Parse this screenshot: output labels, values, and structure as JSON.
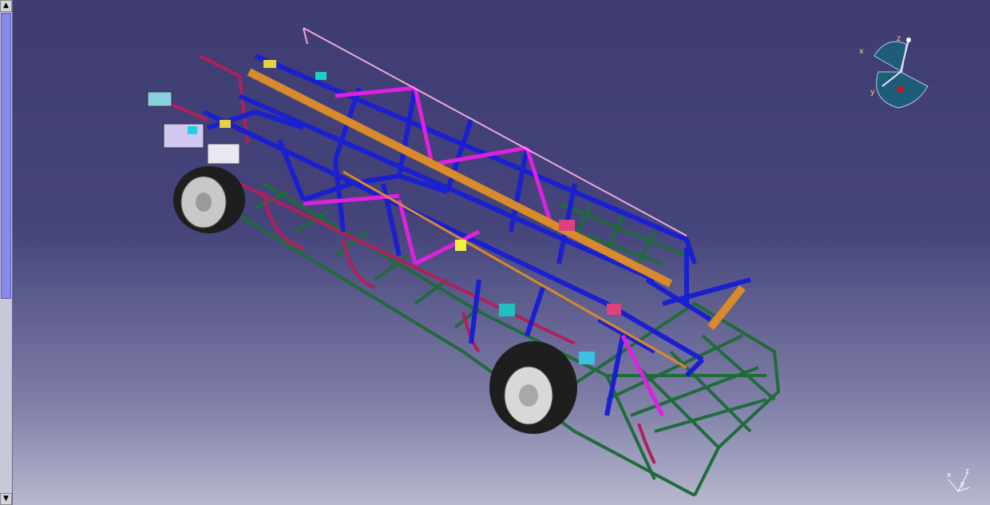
{
  "scrollbar": {
    "up_icon": "arrow-up-icon",
    "down_icon": "arrow-down-icon",
    "position_fraction": 0.0,
    "visible_fraction": 0.59
  },
  "compass": {
    "x_label": "x",
    "y_label": "y",
    "z_label": "z"
  },
  "axis_triad": {
    "x_label": "x",
    "y_label": "y",
    "z_label": "z"
  },
  "colors": {
    "background_top": "#3e3c72",
    "background_bottom": "#b8b8cf",
    "frame_blue": "#1a1fd0",
    "frame_magenta": "#e020e0",
    "frame_green": "#1f6b3a",
    "frame_orange": "#d98a2a",
    "frame_crimson": "#c0206a",
    "tire": "#2a2a2a"
  }
}
